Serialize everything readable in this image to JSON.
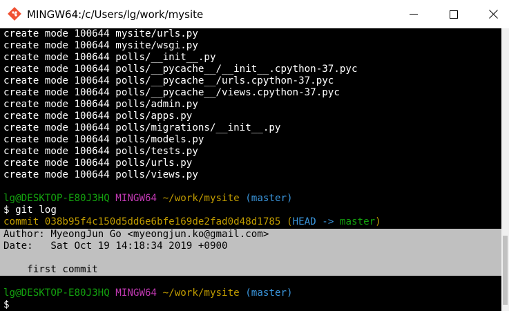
{
  "window": {
    "title": "MINGW64:/c/Users/lg/work/mysite",
    "minimize_icon": "minimize-icon",
    "maximize_icon": "maximize-icon",
    "close_icon": "close-icon",
    "app_icon": "git-bash-icon"
  },
  "terminal": {
    "create_lines": [
      "create mode 100644 mysite/urls.py",
      "create mode 100644 mysite/wsgi.py",
      "create mode 100644 polls/__init__.py",
      "create mode 100644 polls/__pycache__/__init__.cpython-37.pyc",
      "create mode 100644 polls/__pycache__/urls.cpython-37.pyc",
      "create mode 100644 polls/__pycache__/views.cpython-37.pyc",
      "create mode 100644 polls/admin.py",
      "create mode 100644 polls/apps.py",
      "create mode 100644 polls/migrations/__init__.py",
      "create mode 100644 polls/models.py",
      "create mode 100644 polls/tests.py",
      "create mode 100644 polls/urls.py",
      "create mode 100644 polls/views.py"
    ],
    "prompt": {
      "user_host": "lg@DESKTOP-E80J3HQ",
      "env": "MINGW64",
      "path": "~/work/mysite",
      "branch": "(master)",
      "symbol": "$"
    },
    "command": "git log",
    "commit": {
      "label": "commit",
      "hash": "038b95f4c150d5dd6e6bfe169de2fad0d48d1785",
      "paren_open": "(",
      "head": "HEAD",
      "arrow": "->",
      "branch": "master",
      "paren_close": ")",
      "author_line": "Author: MyeongJun Go <myeongjun.ko@gmail.com>",
      "date_line": "Date:   Sat Oct 19 14:18:34 2019 +0900",
      "message": "    first commit"
    }
  },
  "colors": {
    "terminal_bg": "#000000",
    "text": "#ffffff",
    "green": "#13a10e",
    "magenta": "#c239b3",
    "yellow": "#c19c00",
    "cyan": "#3a96dd",
    "selection": "#c0c0c0"
  }
}
